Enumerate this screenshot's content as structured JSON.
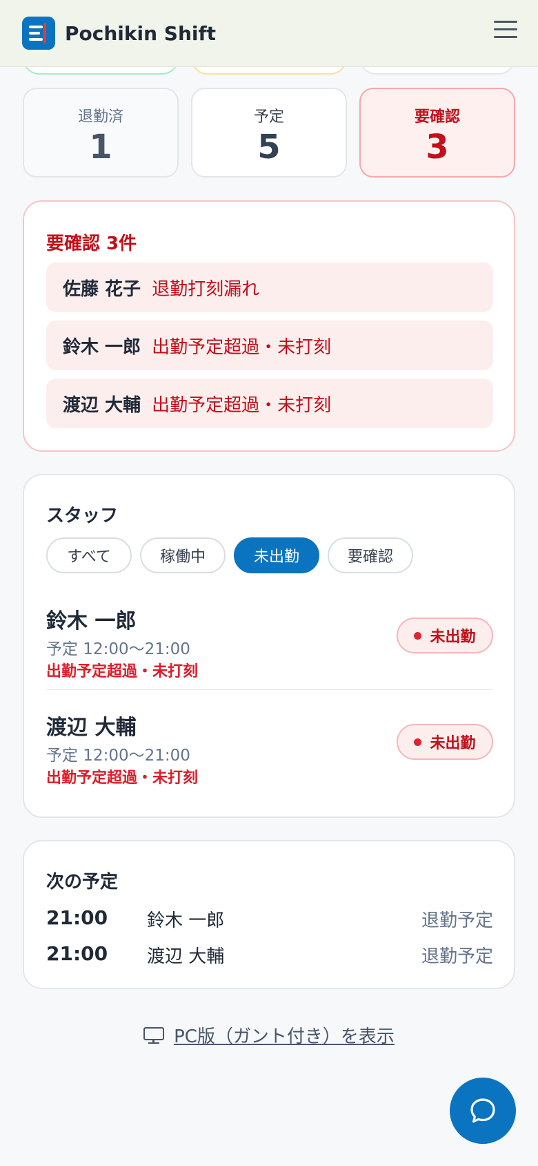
{
  "header": {
    "app_title": "Pochikin Shift",
    "menu_icon": "hamburger-menu-icon"
  },
  "stats": [
    {
      "label": "退勤済",
      "value": "1"
    },
    {
      "label": "予定",
      "value": "5"
    },
    {
      "label": "要確認",
      "value": "3"
    }
  ],
  "alerts": {
    "title": "要確認 3件",
    "items": [
      {
        "name": "佐藤 花子",
        "message": "退勤打刻漏れ"
      },
      {
        "name": "鈴木 一郎",
        "message": "出勤予定超過・未打刻"
      },
      {
        "name": "渡辺 大輔",
        "message": "出勤予定超過・未打刻"
      }
    ]
  },
  "staff": {
    "title": "スタッフ",
    "filters": [
      "すべて",
      "稼働中",
      "未出勤",
      "要確認"
    ],
    "active_filter": "未出勤",
    "rows": [
      {
        "name": "鈴木 一郎",
        "schedule": "予定 12:00〜21:00",
        "warning": "出勤予定超過・未打刻",
        "status": "未出勤"
      },
      {
        "name": "渡辺 大輔",
        "schedule": "予定 12:00〜21:00",
        "warning": "出勤予定超過・未打刻",
        "status": "未出勤"
      }
    ]
  },
  "next_schedule": {
    "title": "次の予定",
    "rows": [
      {
        "time": "21:00",
        "name": "鈴木 一郎",
        "event": "退勤予定"
      },
      {
        "time": "21:00",
        "name": "渡辺 大輔",
        "event": "退勤予定"
      }
    ]
  },
  "pc_link": {
    "label": "PC版（ガント付き）を表示",
    "icon": "monitor-icon"
  },
  "fab": {
    "icon": "chat-bubble-icon"
  },
  "colors": {
    "primary": "#0b74c0",
    "danger": "#c0101a",
    "alert_bg": "#fdeeee"
  }
}
